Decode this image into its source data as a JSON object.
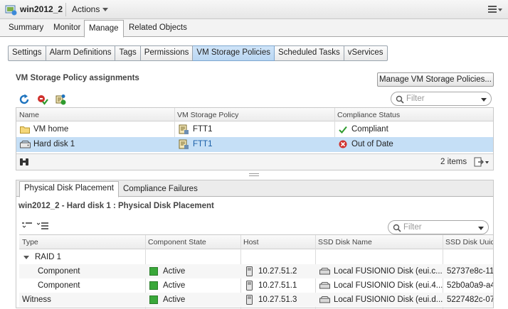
{
  "window": {
    "title": "win2012_2",
    "actions_label": "Actions"
  },
  "main_tabs": [
    "Summary",
    "Monitor",
    "Manage",
    "Related Objects"
  ],
  "sub_tabs": [
    "Settings",
    "Alarm Definitions",
    "Tags",
    "Permissions",
    "VM Storage Policies",
    "Scheduled Tasks",
    "vServices"
  ],
  "assignments": {
    "title": "VM Storage Policy assignments",
    "manage_button": "Manage VM Storage Policies...",
    "filter_placeholder": "Filter",
    "columns": [
      "Name",
      "VM Storage Policy",
      "Compliance Status"
    ],
    "rows": [
      {
        "name": "VM home",
        "policy": "FTT1",
        "status": "Compliant"
      },
      {
        "name": "Hard disk 1",
        "policy": "FTT1",
        "status": "Out of Date"
      }
    ],
    "items_count": "2 items"
  },
  "placement": {
    "tabs": [
      "Physical Disk Placement",
      "Compliance Failures"
    ],
    "title": "win2012_2 - Hard disk 1 : Physical Disk Placement",
    "filter_placeholder": "Filter",
    "columns": [
      "Type",
      "Component State",
      "Host",
      "SSD Disk Name",
      "SSD Disk Uuid"
    ],
    "rows": [
      {
        "type": "RAID 1",
        "state": "",
        "host": "",
        "ssd_name": "",
        "ssd_uuid": ""
      },
      {
        "type": "Component",
        "state": "Active",
        "host": "10.27.51.2",
        "ssd_name": "Local FUSIONIO Disk (eui.c...",
        "ssd_uuid": "52737e8c-11"
      },
      {
        "type": "Component",
        "state": "Active",
        "host": "10.27.51.1",
        "ssd_name": "Local FUSIONIO Disk (eui.4...",
        "ssd_uuid": "52b0a0a9-a4"
      },
      {
        "type": "Witness",
        "state": "Active",
        "host": "10.27.51.3",
        "ssd_name": "Local FUSIONIO Disk (eui.d...",
        "ssd_uuid": "5227482c-07"
      }
    ]
  },
  "colors": {
    "selected_row": "#c5dff6",
    "active_subtab": "#b9d6f2",
    "state_active": "#3aa83a",
    "error": "#d0312d",
    "ok": "#2e9b2e"
  }
}
